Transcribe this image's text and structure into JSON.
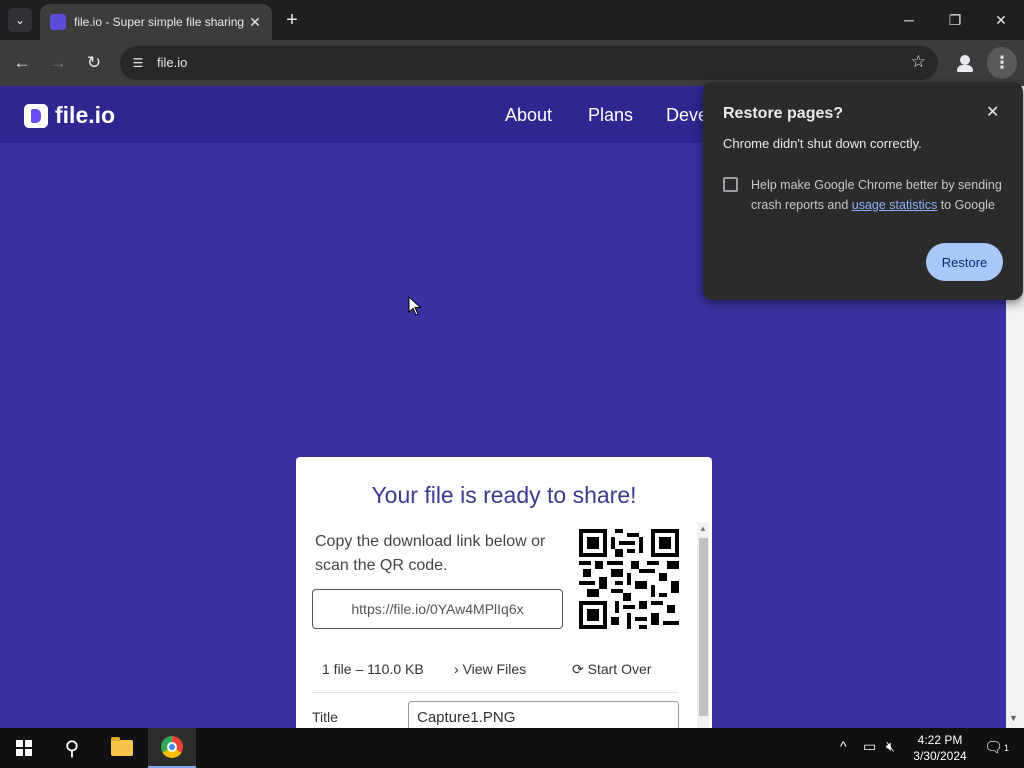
{
  "browser": {
    "tab_title": "file.io - Super simple file sharing",
    "url": "file.io",
    "new_tab_symbol": "+",
    "tab_close_symbol": "✕",
    "window_minimize": "─",
    "window_restore": "❐",
    "window_close": "✕"
  },
  "site": {
    "logo_text": "file.io",
    "nav": [
      "About",
      "Plans",
      "Deve"
    ]
  },
  "card": {
    "title": "Your file is ready to share!",
    "description": "Copy the download link below or scan the QR code.",
    "link": "https://file.io/0YAw4MPlIq6x",
    "file_info": "1 file – 110.0 KB",
    "view_files": "View Files",
    "start_over": "Start Over",
    "title_label": "Title",
    "title_value": "Capture1.PNG"
  },
  "popup": {
    "title": "Restore pages?",
    "message": "Chrome didn't shut down correctly.",
    "help_prefix": "Help make Google Chrome better by sending crash reports and ",
    "help_link": "usage statistics",
    "help_suffix": " to Google",
    "restore_label": "Restore",
    "close_symbol": "✕"
  },
  "taskbar": {
    "time": "4:22 PM",
    "date": "3/30/2024",
    "notification_count": "1"
  },
  "colors": {
    "page_bg": "#3b31a3",
    "header_bg": "#2f2690",
    "card_title": "#3b3a8f",
    "restore_button": "#a8c7fa"
  }
}
